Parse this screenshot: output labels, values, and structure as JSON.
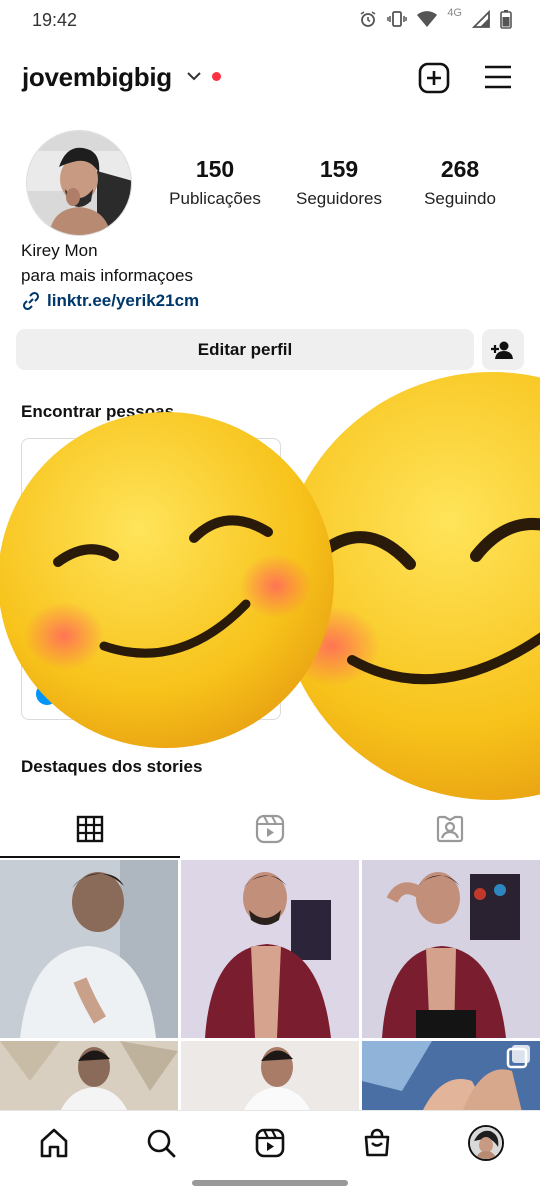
{
  "status_bar": {
    "time": "19:42",
    "network": "4G"
  },
  "header": {
    "username": "jovembigbig"
  },
  "profile": {
    "stats": [
      {
        "value": "150",
        "label": "Publicações"
      },
      {
        "value": "159",
        "label": "Seguidores"
      },
      {
        "value": "268",
        "label": "Seguindo"
      }
    ],
    "name": "Kirey Mon",
    "bio": "para mais informaçoes",
    "link": "linktr.ee/yerik21cm"
  },
  "actions": {
    "edit_label": "Editar perfil"
  },
  "sections": {
    "discover_title": "Encontrar pessoas",
    "highlights_title": "Destaques dos stories"
  },
  "tabs": [
    {
      "icon": "grid-icon",
      "active": true
    },
    {
      "icon": "reels-icon",
      "active": false
    },
    {
      "icon": "tagged-icon",
      "active": false
    }
  ],
  "bottom_nav": [
    "home-icon",
    "search-icon",
    "reels-icon",
    "shop-icon",
    "profile-avatar"
  ],
  "colors": {
    "link": "#00376b",
    "notification": "#ff3040",
    "button_bg": "#efefef",
    "emoji_yellow": "#f7c21a"
  }
}
